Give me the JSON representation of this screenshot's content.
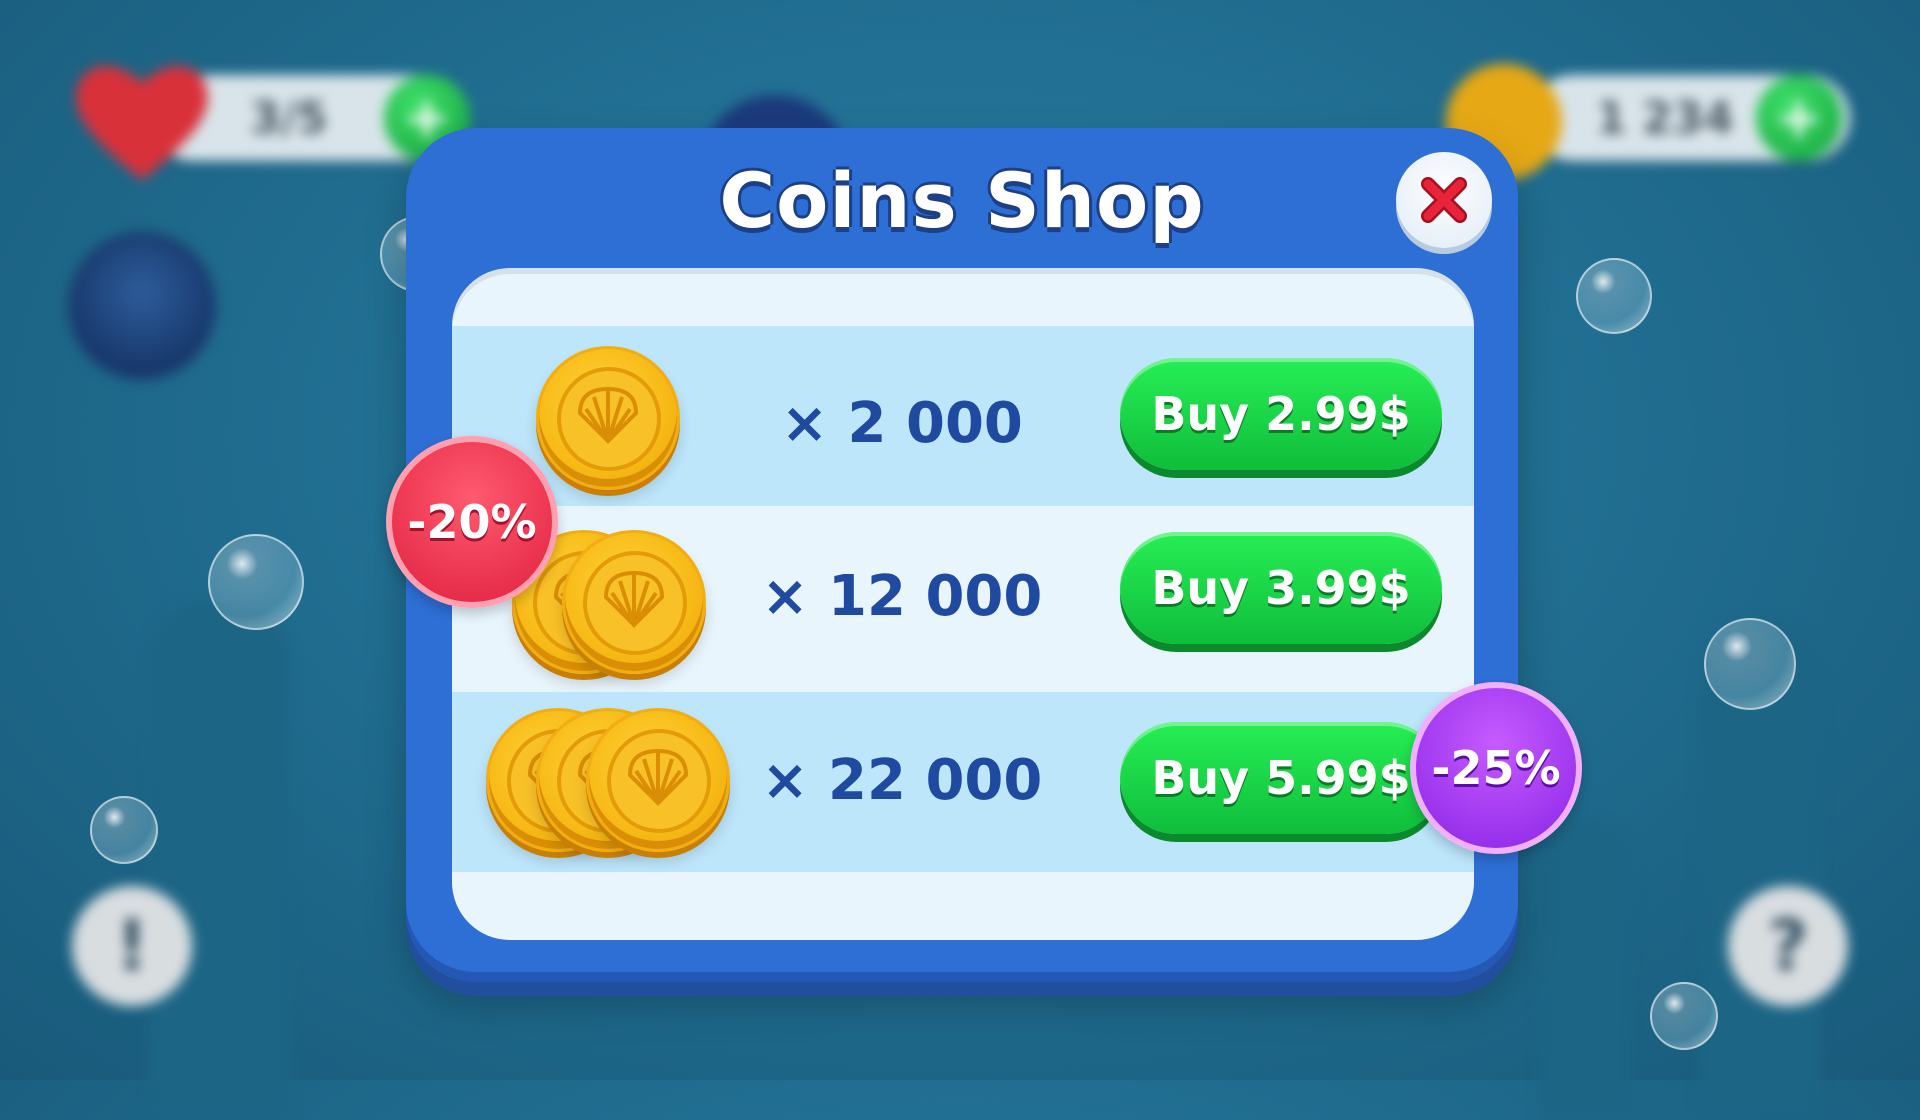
{
  "hud": {
    "lives": "3/5",
    "coins": "1 234",
    "plus_symbol": "+",
    "info_symbol": "!",
    "help_symbol": "?"
  },
  "shop": {
    "title": "Coins Shop",
    "close_icon": "close-x-icon",
    "offers": [
      {
        "amount": "× 2 000",
        "button": "Buy 2.99$",
        "coins_shown": 1,
        "badge": ""
      },
      {
        "amount": "× 12 000",
        "button": "Buy 3.99$",
        "coins_shown": 2,
        "badge": "-20%"
      },
      {
        "amount": "× 22 000",
        "button": "Buy 5.99$",
        "coins_shown": 3,
        "badge": "-25%"
      }
    ]
  },
  "colors": {
    "modal_blue": "#2e6fd6",
    "buy_green": "#13d146",
    "badge_red": "#e8304a",
    "badge_purple": "#a63bf0",
    "coin_gold": "#f7b916"
  }
}
